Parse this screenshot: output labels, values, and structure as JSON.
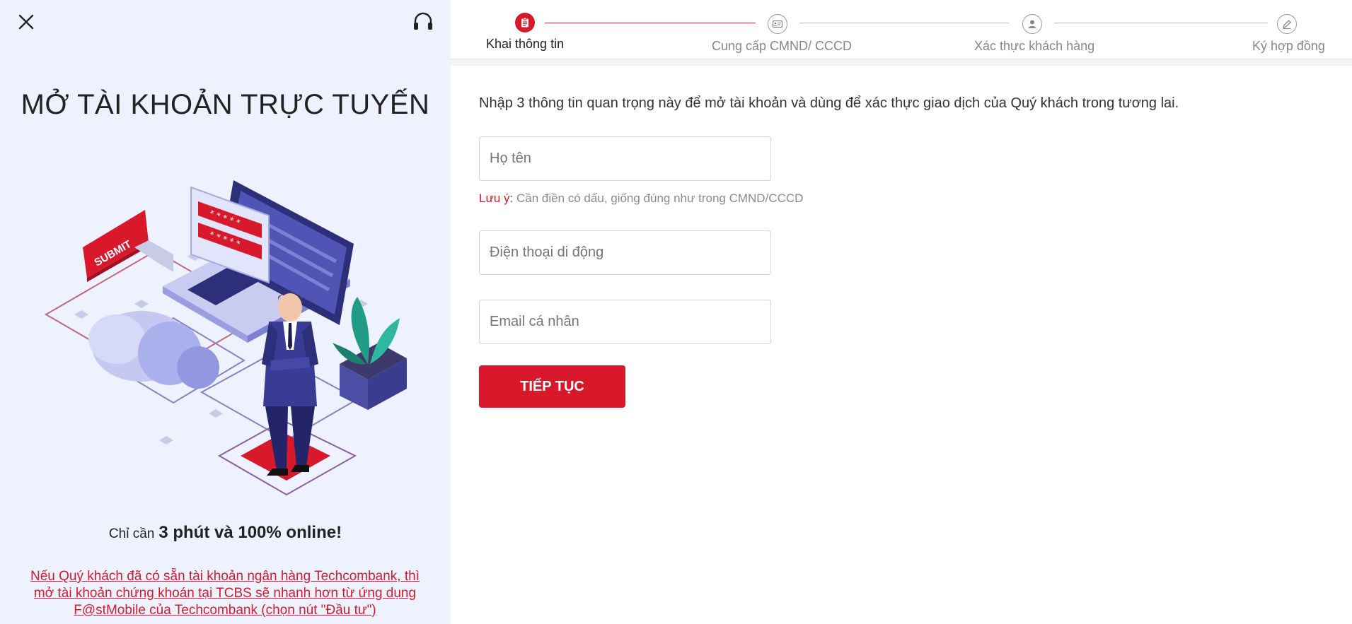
{
  "icons": {
    "close": "close-icon",
    "support": "headset-icon"
  },
  "left": {
    "title": "MỞ TÀI KHOẢN TRỰC TUYẾN",
    "illustration_sign": "SUBMIT",
    "tagline_small": "Chỉ cần",
    "tagline_big": "3 phút và 100% online!",
    "techcombank_link": "Nếu Quý khách đã có sẵn tài khoản ngân hàng Techcombank, thì mở tài khoản chứng khoán tại TCBS sẽ nhanh hơn từ ứng dụng F@stMobile của Techcombank (chọn nút \"Đầu tư\")"
  },
  "stepper": {
    "steps": [
      {
        "label": "Khai thông tin",
        "icon": "clipboard-icon",
        "active": true
      },
      {
        "label": "Cung cấp CMND/ CCCD",
        "icon": "id-card-icon",
        "active": false
      },
      {
        "label": "Xác thực khách hàng",
        "icon": "user-icon",
        "active": false
      },
      {
        "label": "Ký hợp đồng",
        "icon": "pen-icon",
        "active": false
      }
    ]
  },
  "form": {
    "intro": "Nhập 3 thông tin quan trọng này để mở tài khoản và dùng để xác thực giao dịch của Quý khách trong tương lai.",
    "name_placeholder": "Họ tên",
    "note_label": "Lưu ý:",
    "note_text": "Cần điền có dấu, giống đúng như trong CMND/CCCD",
    "phone_placeholder": "Điện thoại di động",
    "email_placeholder": "Email cá nhân",
    "continue_label": "TIẾP TỤC"
  },
  "colors": {
    "brand_red": "#d7192b",
    "left_bg": "#eef2fe",
    "illustration_navy": "#2e2f7a",
    "illustration_purple": "#6a6ac9"
  }
}
